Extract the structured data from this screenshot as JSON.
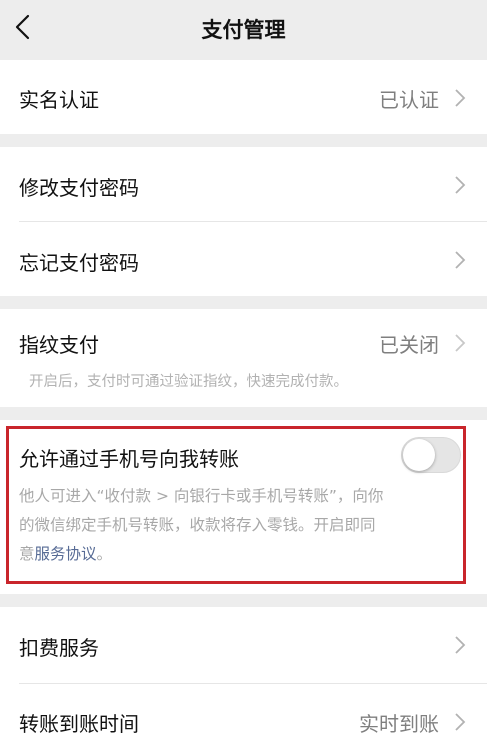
{
  "nav": {
    "title": "支付管理",
    "back_icon": "chevron-left-icon"
  },
  "real_name": {
    "label": "实名认证",
    "value": "已认证"
  },
  "password": {
    "change_label": "修改支付密码",
    "forgot_label": "忘记支付密码"
  },
  "fingerprint": {
    "label": "指纹支付",
    "value": "已关闭",
    "description": "开启后，支付时可通过验证指纹，快速完成付款。"
  },
  "phone_transfer": {
    "label": "允许通过手机号向我转账",
    "toggle_on": false,
    "desc_line1": "他人可进入“收付款 > 向银行卡或手机号转账”，向你",
    "desc_line2": "的微信绑定手机号转账，收款将存入零钱。开启即同",
    "desc_line3_prefix": "意",
    "desc_link": "服务协议",
    "desc_line3_suffix": "。"
  },
  "deduction": {
    "label": "扣费服务"
  },
  "arrival_time": {
    "label": "转账到账时间",
    "value": "实时到账"
  },
  "colors": {
    "background": "#ededed",
    "link": "#576b95",
    "highlight": "#c9252b"
  }
}
